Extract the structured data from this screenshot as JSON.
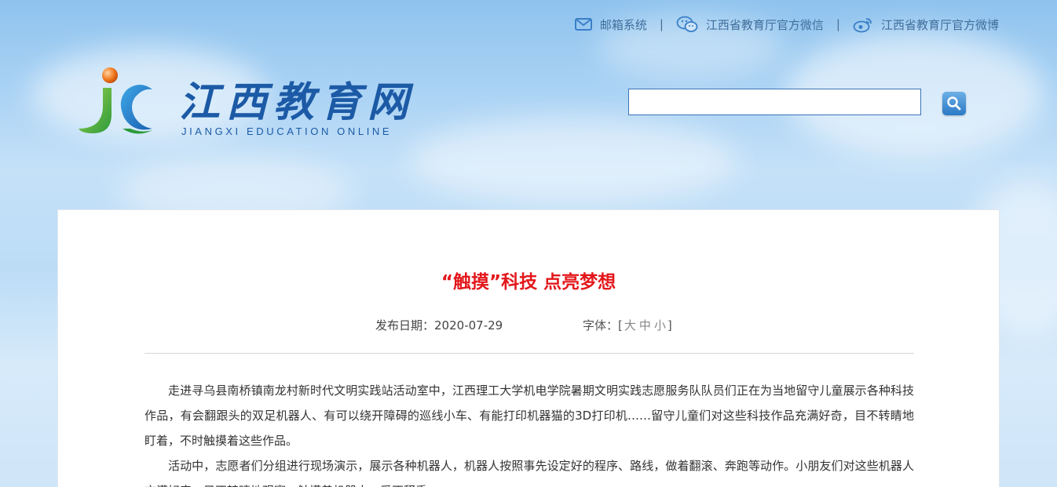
{
  "header": {
    "links": [
      {
        "label": "邮箱系统",
        "icon": "mail-icon"
      },
      {
        "label": "江西省教育厅官方微信",
        "icon": "wechat-icon"
      },
      {
        "label": "江西省教育厅官方微博",
        "icon": "weibo-icon"
      }
    ],
    "separator": "|",
    "logo": {
      "cn": "江西教育网",
      "en": "JIANGXI EDUCATION ONLINE"
    },
    "search": {
      "value": "",
      "placeholder": "",
      "button_icon": "search-icon"
    }
  },
  "colors": {
    "accent": "#1c5aa6",
    "title": "#e3171b"
  },
  "article": {
    "title": "“触摸”科技 点亮梦想",
    "date_label": "发布日期：",
    "date": "2020-07-29",
    "font_label": "字体：",
    "font_open": "[",
    "font_large": "大",
    "font_medium": "中",
    "font_small": "小",
    "font_close": "]",
    "paragraphs": [
      "走进寻乌县南桥镇南龙村新时代文明实践站活动室中，江西理工大学机电学院暑期文明实践志愿服务队队员们正在为当地留守儿童展示各种科技作品，有会翻跟头的双足机器人、有可以绕开障碍的巡线小车、有能打印机器猫的3D打印机……留守儿童们对这些科技作品充满好奇，目不转睛地盯着，不时触摸着这些作品。",
      "活动中，志愿者们分组进行现场演示，展示各种机器人，机器人按照事先设定好的程序、路线，做着翻滚、奔跑等动作。小朋友们对这些机器人充满好奇，目不转睛地观察，触摸着机器人，爱不释手。"
    ]
  }
}
